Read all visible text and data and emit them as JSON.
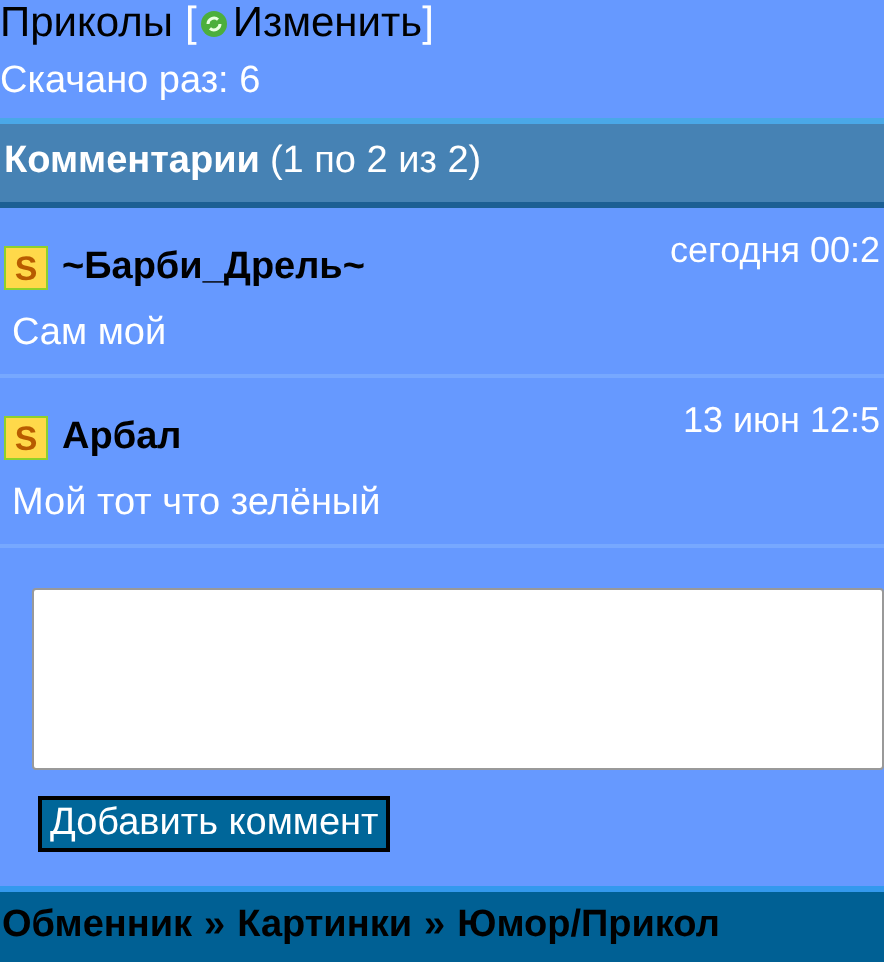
{
  "file": {
    "category": "Приколы",
    "open_bracket": "[",
    "edit_link": "Изменить",
    "close_bracket": "]",
    "downloads": "Скачано раз: 6"
  },
  "comments_header": {
    "title": "Комментарии",
    "range": "(1 по 2 из 2)"
  },
  "comments": [
    {
      "badge": "S",
      "author": "~Барби_Дрель~",
      "date": "сегодня 00:2",
      "text": "Сам мой"
    },
    {
      "badge": "S",
      "author": "Арбал",
      "date": "13 июн 12:5",
      "text": "Мой тот что зелёный"
    }
  ],
  "comment_form": {
    "button": "Добавить коммент"
  },
  "breadcrumbs": {
    "separator": "»",
    "items": [
      "Обменник",
      "Картинки",
      "Юмор/Прикол"
    ]
  }
}
